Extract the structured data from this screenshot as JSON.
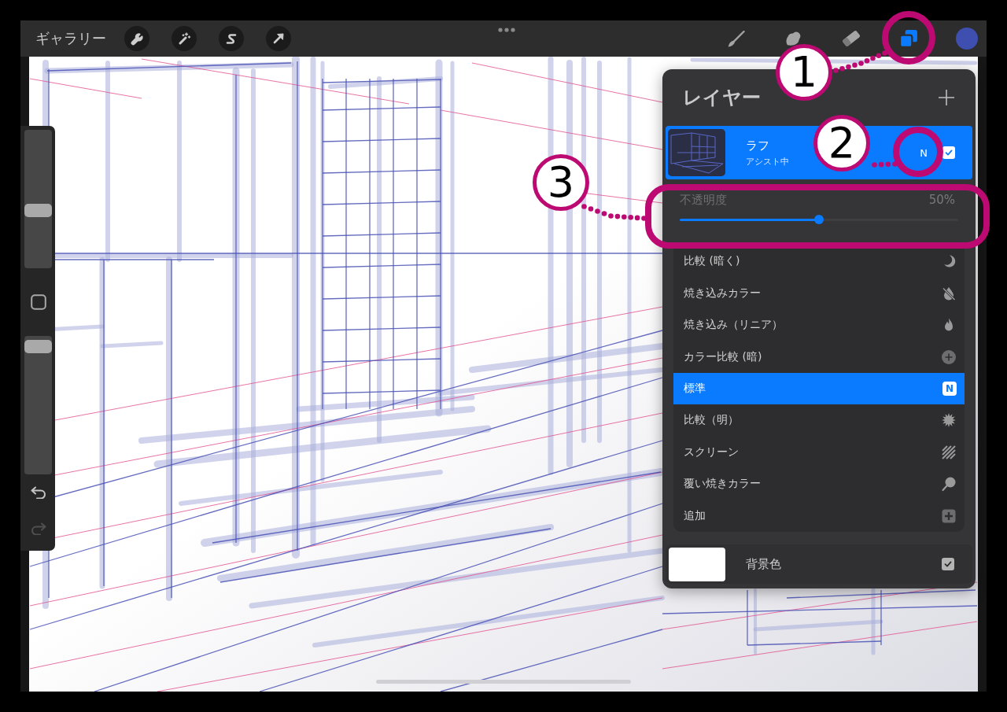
{
  "top_bar": {
    "gallery": "ギャラリー",
    "tools": [
      {
        "selected": false
      },
      {
        "selected": false
      },
      {
        "selected": false
      },
      {
        "selected": true
      }
    ],
    "color_swatch": {
      "color": "#3e4fb0"
    }
  },
  "sidebar": {
    "sliders": [
      {
        "level": 0.41
      },
      {
        "level": 0.97
      }
    ],
    "undo": {
      "disabled": false
    },
    "redo": {
      "disabled": true
    }
  },
  "layers_panel": {
    "title": "レイヤー",
    "layers": [
      {
        "name": "ラフ",
        "status": "アシスト中",
        "blend_badge": "N",
        "visible": true,
        "selected": true
      }
    ],
    "opacity": {
      "label": "不透明度",
      "reading": "50%",
      "level": 0.5
    },
    "blend_modes": [
      {
        "label": "比較 (暗く)",
        "selected": false
      },
      {
        "label": "焼き込みカラー",
        "selected": false
      },
      {
        "label": "焼き込み（リニア）",
        "selected": false
      },
      {
        "label": "カラー比較 (暗)",
        "selected": false
      },
      {
        "label": "標準",
        "badge": "N",
        "selected": true
      },
      {
        "label": "比較（明）",
        "selected": false
      },
      {
        "label": "スクリーン",
        "selected": false
      },
      {
        "label": "覆い焼きカラー",
        "selected": false
      },
      {
        "label": "追加",
        "selected": false
      }
    ],
    "background": {
      "label": "背景色",
      "visible": true
    }
  },
  "callouts": [
    {
      "number": "1"
    },
    {
      "number": "2"
    },
    {
      "number": "3"
    }
  ]
}
